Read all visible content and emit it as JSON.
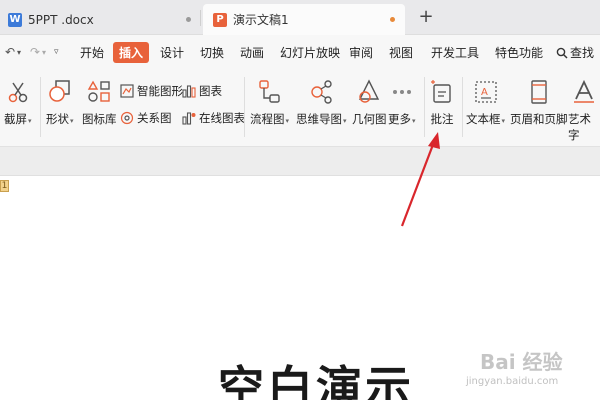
{
  "tabs": [
    {
      "label": "5PPT .docx",
      "icon_letter": "W"
    },
    {
      "label": "演示文稿1",
      "icon_letter": "P"
    }
  ],
  "new_tab_label": "+",
  "menu": {
    "items": [
      "开始",
      "插入",
      "设计",
      "切换",
      "动画",
      "幻灯片放映",
      "审阅",
      "视图",
      "开发工具",
      "特色功能"
    ],
    "active": "插入",
    "search_label": "查找"
  },
  "ribbon": {
    "screenshot": "截屏",
    "shapes": "形状",
    "icon_library": "图标库",
    "smart_art": "智能图形",
    "relationship": "关系图",
    "chart": "图表",
    "online_chart": "在线图表",
    "flowchart": "流程图",
    "mindmap": "思维导图",
    "geometry": "几何图",
    "more": "更多",
    "comment": "批注",
    "textbox": "文本框",
    "header_footer": "页眉和页脚",
    "wordart": "艺术字"
  },
  "slide": {
    "number": "1",
    "title": "空白演示"
  },
  "watermark": {
    "brand": "Bai  经验",
    "url": "jingyan.baidu.com"
  },
  "colors": {
    "accent": "#e8623b",
    "annotation_arrow": "#d9262c"
  }
}
